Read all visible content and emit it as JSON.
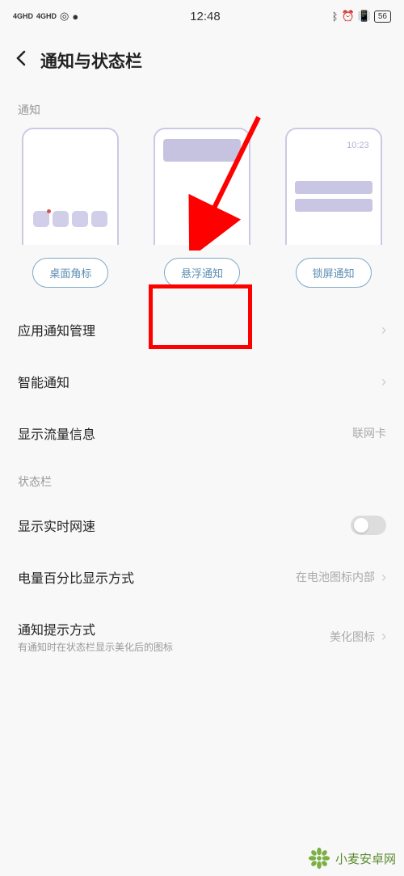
{
  "status_bar": {
    "signal1": "4GHD",
    "signal2": "4GHD",
    "time": "12:48",
    "battery": "56"
  },
  "header": {
    "title": "通知与状态栏"
  },
  "sections": {
    "notification_label": "通知",
    "statusbar_label": "状态栏"
  },
  "cards": {
    "badge": "桌面角标",
    "floating": "悬浮通知",
    "lockscreen": "锁屏通知",
    "lock_time": "10:23"
  },
  "list": {
    "app_notification": "应用通知管理",
    "smart_notification": "智能通知",
    "traffic_info": {
      "label": "显示流量信息",
      "value": "联网卡"
    },
    "realtime_speed": "显示实时网速",
    "battery_percent": {
      "label": "电量百分比显示方式",
      "value": "在电池图标内部"
    },
    "notification_style": {
      "label": "通知提示方式",
      "sub": "有通知时在状态栏显示美化后的图标",
      "value": "美化图标"
    }
  },
  "watermark": "小麦安卓网"
}
